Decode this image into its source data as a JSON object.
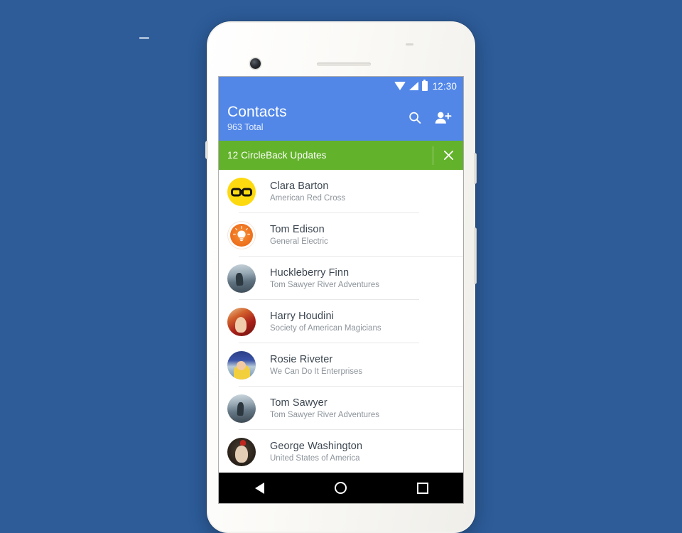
{
  "device": {
    "name": "android-phone-mockup",
    "background_color": "#2d5c99",
    "body_color": "#f7f6f2"
  },
  "status_bar": {
    "time": "12:30",
    "icons": [
      "wifi-icon",
      "signal-icon",
      "battery-icon"
    ],
    "background_color": "#5287e8"
  },
  "app_bar": {
    "title": "Contacts",
    "subtitle": "963 Total",
    "background_color": "#5287e8",
    "actions": [
      {
        "name": "search-icon",
        "label": "Search"
      },
      {
        "name": "add-contact-icon",
        "label": "Add contact"
      }
    ]
  },
  "banner": {
    "text": "12 CircleBack Updates",
    "background_color": "#63b22b",
    "close_label": "Dismiss"
  },
  "contacts": [
    {
      "name": "Clara Barton",
      "company": "American Red Cross",
      "avatar": "av-clara"
    },
    {
      "name": "Tom Edison",
      "company": "General Electric",
      "avatar": "av-edison"
    },
    {
      "name": "Huckleberry Finn",
      "company": "Tom Sawyer River Adventures",
      "avatar": "av-huck"
    },
    {
      "name": "Harry Houdini",
      "company": "Society of American Magicians",
      "avatar": "av-houdini"
    },
    {
      "name": "Rosie Riveter",
      "company": "We Can Do It Enterprises",
      "avatar": "av-rosie"
    },
    {
      "name": "Tom Sawyer",
      "company": "Tom Sawyer River Adventures",
      "avatar": "av-sawyer"
    },
    {
      "name": "George Washington",
      "company": "United States of America",
      "avatar": "av-george"
    }
  ],
  "nav_bar": {
    "background_color": "#000000",
    "buttons": [
      {
        "name": "nav-back-button",
        "label": "Back"
      },
      {
        "name": "nav-home-button",
        "label": "Home"
      },
      {
        "name": "nav-recents-button",
        "label": "Recents"
      }
    ]
  }
}
